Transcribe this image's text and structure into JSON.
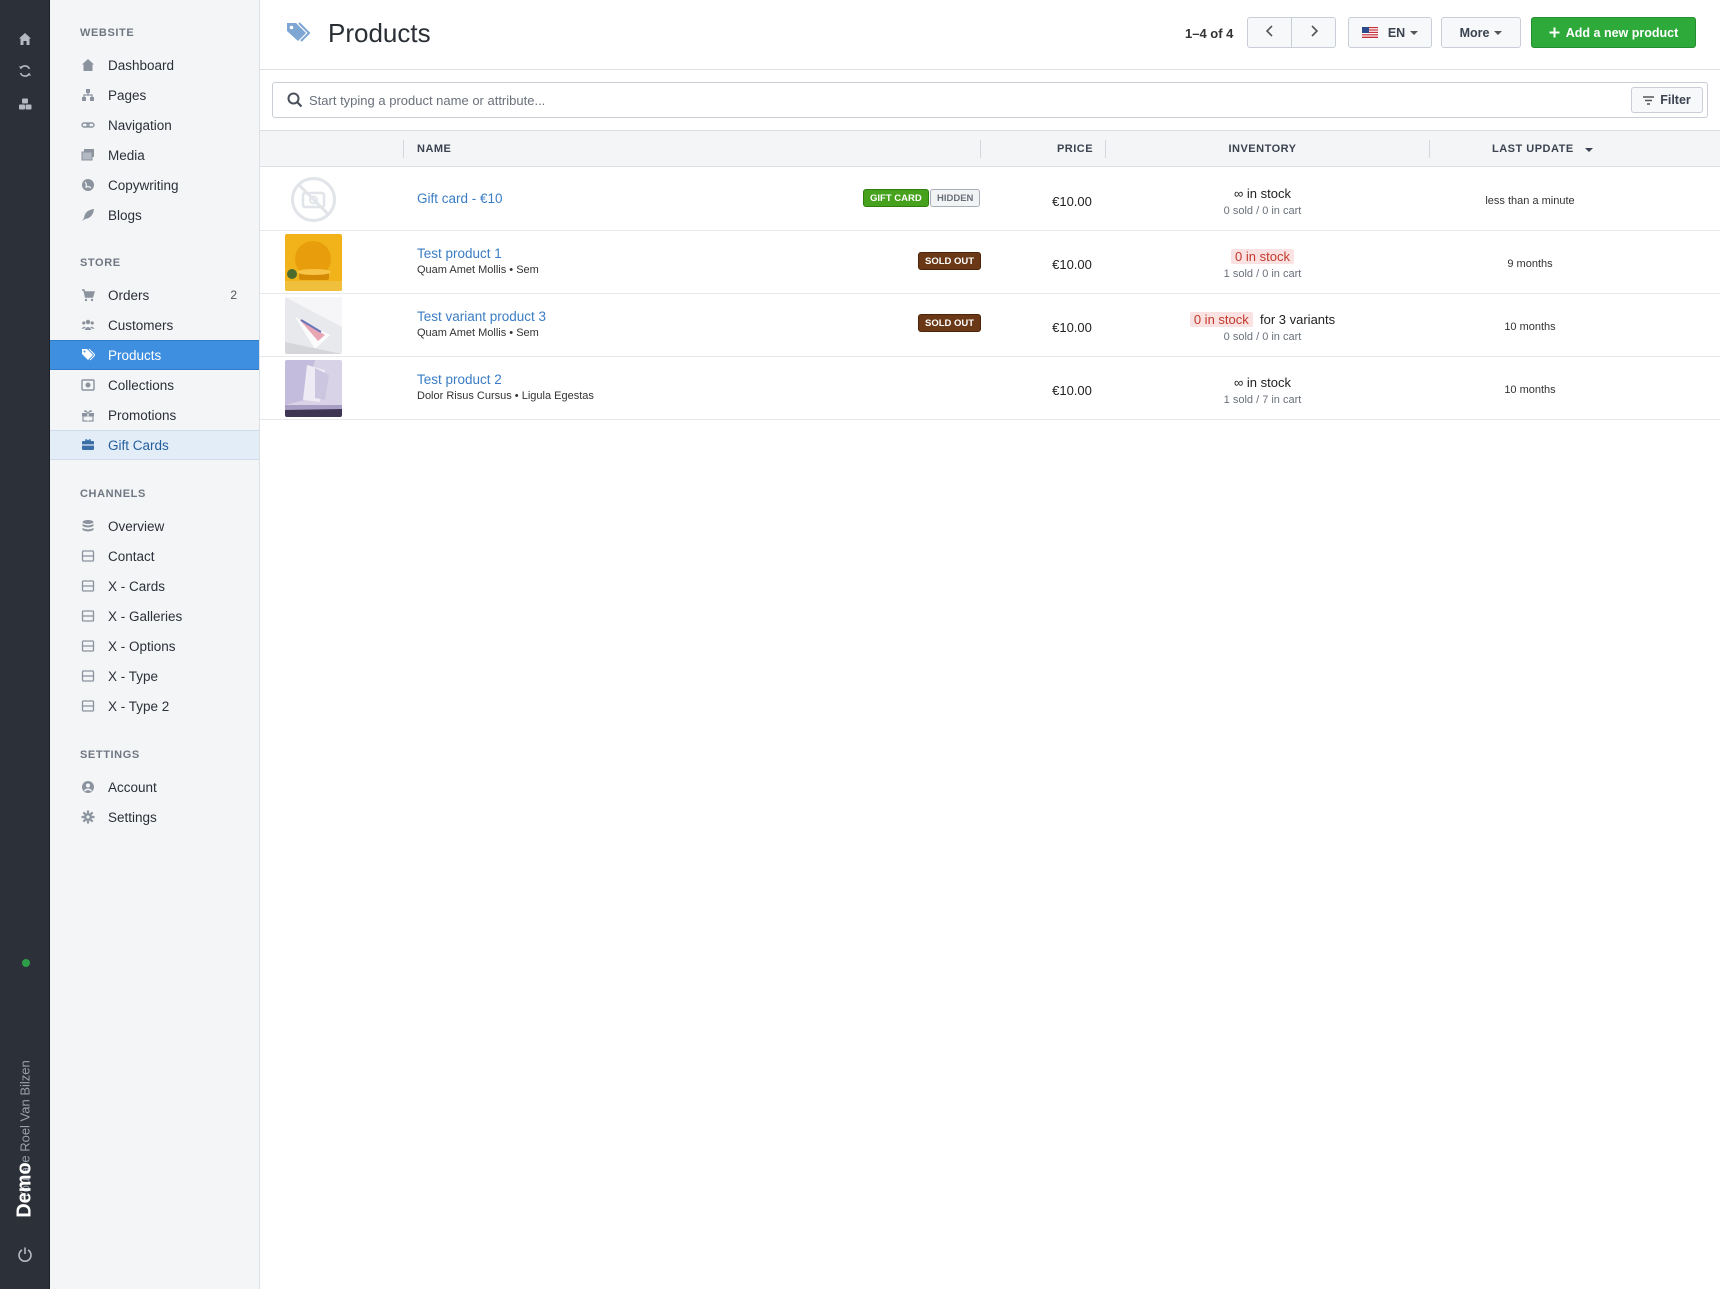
{
  "rail": {
    "user_text": "You are Roel Van Bilzen",
    "brand": "Demo"
  },
  "sidebar": {
    "sections": [
      {
        "title": "WEBSITE",
        "items": [
          {
            "label": "Dashboard",
            "icon": "home-icon"
          },
          {
            "label": "Pages",
            "icon": "sitemap-icon"
          },
          {
            "label": "Navigation",
            "icon": "link-icon"
          },
          {
            "label": "Media",
            "icon": "images-icon"
          },
          {
            "label": "Copywriting",
            "icon": "globe-icon"
          },
          {
            "label": "Blogs",
            "icon": "feather-icon"
          }
        ]
      },
      {
        "title": "STORE",
        "items": [
          {
            "label": "Orders",
            "icon": "cart-icon",
            "count": "2"
          },
          {
            "label": "Customers",
            "icon": "users-icon"
          },
          {
            "label": "Products",
            "icon": "tags-icon",
            "state": "active"
          },
          {
            "label": "Collections",
            "icon": "collection-icon"
          },
          {
            "label": "Promotions",
            "icon": "gift-icon"
          },
          {
            "label": "Gift Cards",
            "icon": "giftcard-icon",
            "state": "soft"
          }
        ]
      },
      {
        "title": "CHANNELS",
        "items": [
          {
            "label": "Overview",
            "icon": "database-icon"
          },
          {
            "label": "Contact",
            "icon": "channel-icon"
          },
          {
            "label": "X - Cards",
            "icon": "channel-icon"
          },
          {
            "label": "X - Galleries",
            "icon": "channel-icon"
          },
          {
            "label": "X - Options",
            "icon": "channel-icon"
          },
          {
            "label": "X - Type",
            "icon": "channel-icon"
          },
          {
            "label": "X - Type 2",
            "icon": "channel-icon"
          }
        ]
      },
      {
        "title": "SETTINGS",
        "items": [
          {
            "label": "Account",
            "icon": "user-circle-icon"
          },
          {
            "label": "Settings",
            "icon": "gear-icon"
          }
        ]
      }
    ]
  },
  "header": {
    "title": "Products",
    "pager_text": "1–4 of 4",
    "lang": "EN",
    "more_label": "More",
    "add_label": "Add a new product"
  },
  "search": {
    "placeholder": "Start typing a product name or attribute...",
    "filter_label": "Filter"
  },
  "table": {
    "columns": [
      "NAME",
      "PRICE",
      "INVENTORY",
      "LAST UPDATE"
    ],
    "rows": [
      {
        "name": "Gift card - €10",
        "subtitle": "",
        "badges": [
          {
            "text": "GIFT CARD",
            "kind": "gift"
          },
          {
            "text": "HIDDEN",
            "kind": "hidden"
          }
        ],
        "price": "€10.00",
        "inventory": {
          "stock": "∞ in stock",
          "variants": "",
          "alert": false,
          "sub": "0 sold / 0 in cart"
        },
        "updated": "less than a minute",
        "thumb": "placeholder"
      },
      {
        "name": "Test product 1",
        "subtitle": "Quam Amet Mollis • Sem",
        "badges": [
          {
            "text": "SOLD OUT",
            "kind": "sold"
          }
        ],
        "price": "€10.00",
        "inventory": {
          "stock": "0 in stock",
          "variants": "",
          "alert": true,
          "sub": "1 sold / 0 in cart"
        },
        "updated": "9 months",
        "thumb": "yellow"
      },
      {
        "name": "Test variant product 3",
        "subtitle": "Quam Amet Mollis • Sem",
        "badges": [
          {
            "text": "SOLD OUT",
            "kind": "sold"
          }
        ],
        "price": "€10.00",
        "inventory": {
          "stock": "0 in stock",
          "variants": "for 3 variants",
          "alert": true,
          "sub": "0 sold / 0 in cart"
        },
        "updated": "10 months",
        "thumb": "paper"
      },
      {
        "name": "Test product 2",
        "subtitle": "Dolor Risus Cursus • Ligula Egestas",
        "badges": [],
        "price": "€10.00",
        "inventory": {
          "stock": "∞ in stock",
          "variants": "",
          "alert": false,
          "sub": "1 sold / 7 in cart"
        },
        "updated": "10 months",
        "thumb": "lavender"
      }
    ]
  },
  "colors": {
    "accent": "#3f8fe0",
    "primary_button": "#2eaa3a",
    "sold_out": "#6a3816",
    "gift_card": "#46a21c"
  }
}
